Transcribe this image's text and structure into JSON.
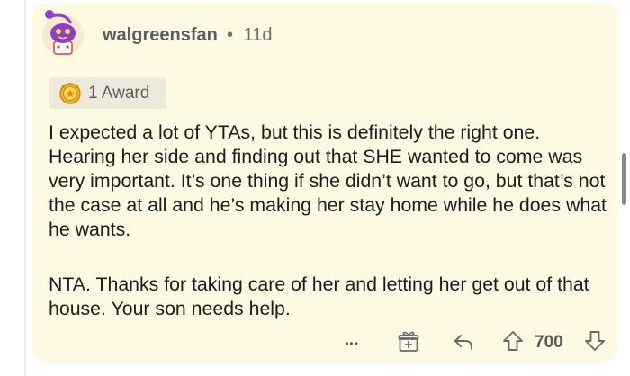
{
  "comment": {
    "username": "walgreensfan",
    "separator": "•",
    "age": "11d",
    "award_label": "1 Award",
    "paragraphs": [
      "I expected a lot of YTAs, but this is definitely the right one. Hearing her side and finding out that SHE wanted to come was very important. It’s one thing if she didn’t want to go, but that’s not the case at all and he’s making her stay home while he does what he wants.",
      "NTA. Thanks for taking care of her and letting her get out of that house. Your son needs help."
    ],
    "actions": {
      "more_label": "•••",
      "vote_count": "700"
    },
    "icons": {
      "avatar": "snoo-avatar-icon",
      "award": "award-medal-icon",
      "more": "more-options-icon",
      "gift": "give-award-icon",
      "reply": "reply-arrow-icon",
      "upvote": "upvote-arrow-icon",
      "downvote": "downvote-arrow-icon"
    },
    "colors": {
      "card_background": "#fdf9e3",
      "avatar_accent": "#8e3fc7",
      "award_gold": "#f0b428"
    }
  }
}
